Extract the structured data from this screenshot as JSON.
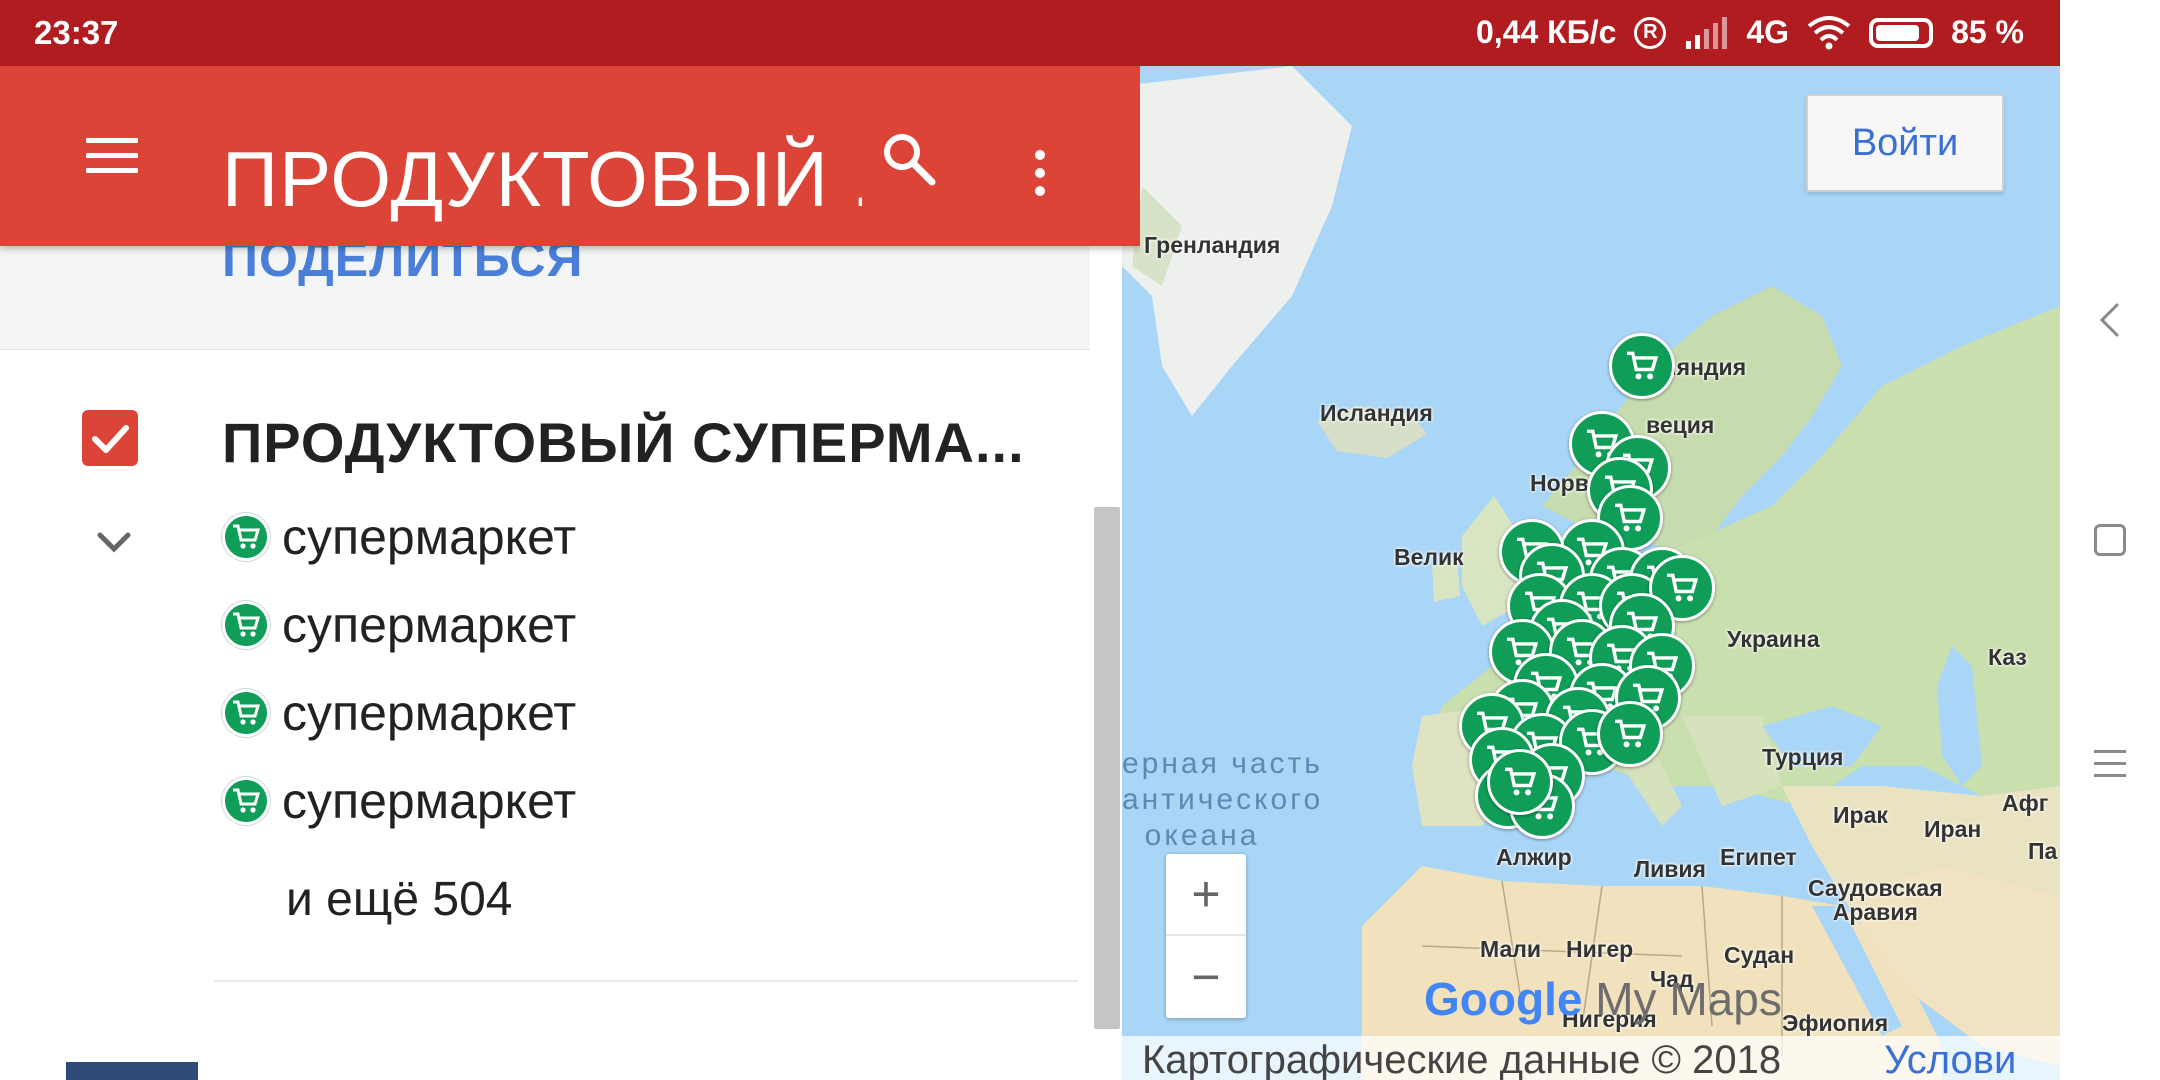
{
  "status_bar": {
    "time": "23:37",
    "speed": "0,44 КБ/с",
    "roaming": "R",
    "network": "4G",
    "battery": "85 %",
    "battery_level": 0.85
  },
  "app_bar": {
    "title": "ПРОДУКТОВЫЙ ...",
    "menu_icon": "menu-icon",
    "search_icon": "search-icon",
    "more_icon": "more-vert-icon"
  },
  "share": {
    "label": "ПОДЕЛИТЬСЯ"
  },
  "layer": {
    "title": "ПРОДУКТОВЫЙ СУПЕРМА...",
    "checked": true,
    "items": [
      {
        "label": "супермаркет",
        "icon": "cart-icon"
      },
      {
        "label": "супермаркет",
        "icon": "cart-icon"
      },
      {
        "label": "супермаркет",
        "icon": "cart-icon"
      },
      {
        "label": "супермаркет",
        "icon": "cart-icon"
      }
    ],
    "more": "и ещё 504"
  },
  "map": {
    "signin": "Войти",
    "labels": {
      "greenland": "Гренландия",
      "iceland": "Исландия",
      "finland": "инляндия",
      "sweden": "веция",
      "norway": "Норв",
      "uk": "Велик",
      "ukraine": "Украина",
      "kaz": "Каз",
      "turkey": "Турция",
      "iraq": "Ирак",
      "iran": "Иран",
      "afg": "Афг",
      "pak": "Па",
      "algeria": "Алжир",
      "libya": "Ливия",
      "egypt": "Египет",
      "saudi": "Саудовская\nАравия",
      "mali": "Мали",
      "niger": "Нигер",
      "chad": "Чад",
      "sudan": "Судан",
      "nigeria": "Нигерия",
      "ethiopia": "Эфиопия"
    },
    "ocean": "ерная часть\nантического\n  океана",
    "zoom_in": "+",
    "zoom_out": "−",
    "logo_google": "Google",
    "logo_mymaps": " My Maps",
    "attribution": "Картографические данные © 2018",
    "terms": "Услови",
    "pin_color": "#0f9d58"
  },
  "colors": {
    "status_bar": "#b01c1f",
    "app_bar": "#db4437",
    "link": "#4a7fd9",
    "water": "#a9d5f6"
  },
  "nav_bar": {
    "back_icon": "back-icon",
    "home_icon": "home-icon",
    "recents_icon": "recents-icon"
  }
}
